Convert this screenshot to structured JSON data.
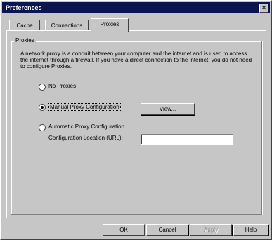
{
  "window": {
    "title": "Preferences",
    "close_glyph": "×"
  },
  "tabs": [
    {
      "label": "Cache",
      "active": false
    },
    {
      "label": "Connections",
      "active": false
    },
    {
      "label": "Proxies",
      "active": true
    }
  ],
  "group": {
    "label": "Proxies",
    "description": "A network proxy is a conduit between your computer and the internet and is used to access the internet through a firewall.  If you have a direct connection to the internet, you do not need to configure Proxies."
  },
  "options": {
    "no_proxies": {
      "label": "No Proxies",
      "checked": false
    },
    "manual": {
      "label": "Manual Proxy Configuration",
      "checked": true
    },
    "automatic": {
      "label": "Automatic Proxy Configuration",
      "checked": false
    }
  },
  "view_button": "View...",
  "config_location": {
    "label": "Configuration Location (URL):",
    "value": ""
  },
  "footer": {
    "ok": "OK",
    "cancel": "Cancel",
    "apply": "Apply",
    "help": "Help"
  }
}
